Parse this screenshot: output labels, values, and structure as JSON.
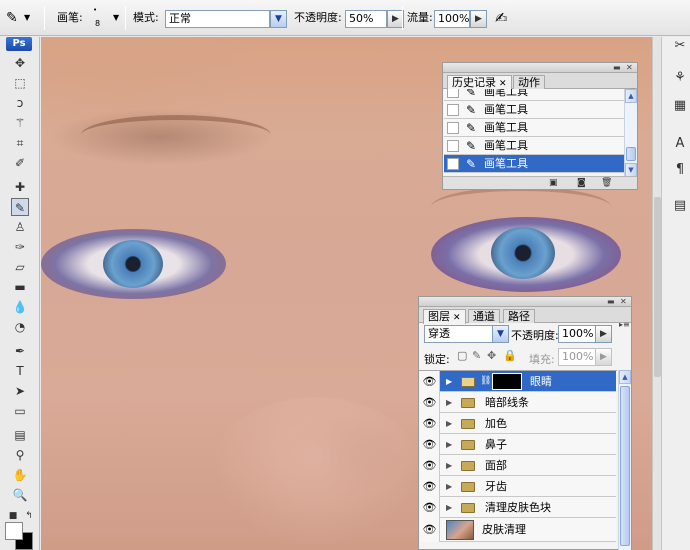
{
  "options_bar": {
    "brush_label": "画笔:",
    "brush_size": "8",
    "mode_label": "模式:",
    "mode_value": "正常",
    "opacity_label": "不透明度:",
    "opacity_value": "50%",
    "flow_label": "流量:",
    "flow_value": "100%"
  },
  "toolbar": {
    "badge": "Ps"
  },
  "history_panel": {
    "tabs": [
      {
        "label": "历史记录"
      },
      {
        "label": "动作"
      }
    ],
    "items": [
      {
        "label": "画笔工具"
      },
      {
        "label": "画笔工具"
      },
      {
        "label": "画笔工具"
      },
      {
        "label": "画笔工具"
      },
      {
        "label": "画笔工具"
      }
    ],
    "selected_index": 4
  },
  "layers_panel": {
    "tabs": [
      {
        "label": "图层"
      },
      {
        "label": "通道"
      },
      {
        "label": "路径"
      }
    ],
    "blend_mode": "穿透",
    "opacity_label": "不透明度:",
    "opacity_value": "100%",
    "lock_label": "锁定:",
    "fill_label": "填充:",
    "fill_value": "100%",
    "layers": [
      {
        "name": "眼睛",
        "type": "group-with-mask",
        "selected": true
      },
      {
        "name": "暗部线条",
        "type": "group"
      },
      {
        "name": "加色",
        "type": "group"
      },
      {
        "name": "鼻子",
        "type": "group"
      },
      {
        "name": "面部",
        "type": "group"
      },
      {
        "name": "牙齿",
        "type": "group"
      },
      {
        "name": "清理皮肤色块",
        "type": "group"
      },
      {
        "name": "皮肤清理",
        "type": "layer"
      }
    ]
  },
  "colors": {
    "selection": "#3169c6",
    "folder": "#c7a95a",
    "skin": "#d6a895"
  }
}
